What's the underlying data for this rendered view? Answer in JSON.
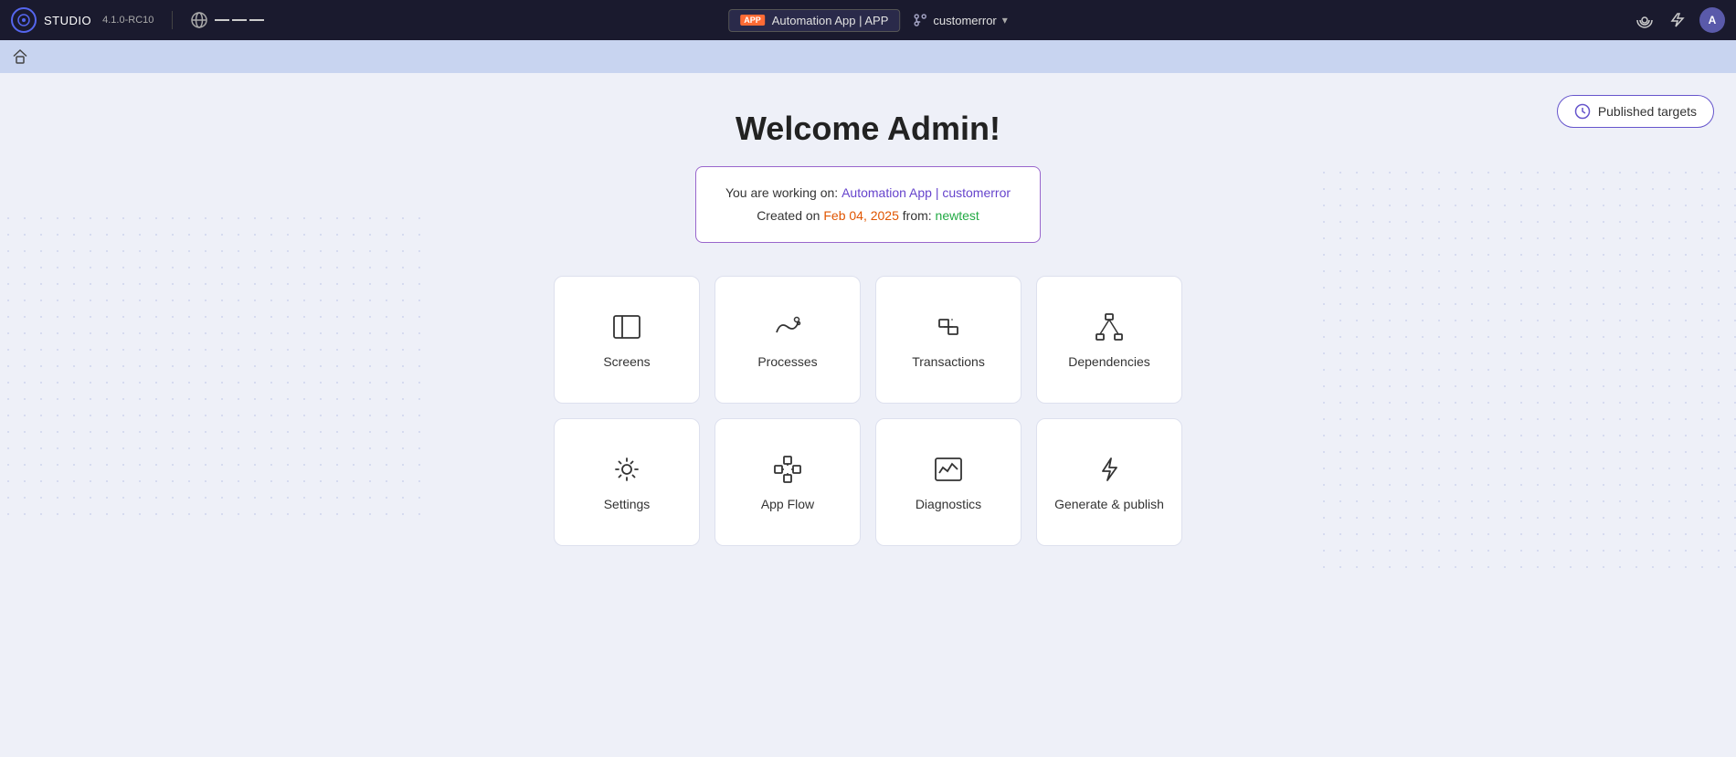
{
  "navbar": {
    "logo_text": "STUDIO",
    "version": "4.1.0-RC10",
    "app_name": "Automation App | APP",
    "branch_name": "customerror",
    "right_icons": [
      "broadcast-icon",
      "lightning-icon",
      "avatar-icon"
    ],
    "avatar_label": "A"
  },
  "sub_navbar": {
    "home_icon": "🏠"
  },
  "published_targets_btn": {
    "label": "Published targets"
  },
  "welcome": {
    "title": "Welcome Admin!",
    "working_on_label": "You are working on:",
    "app_link": "Automation App | customerror",
    "created_label": "Created on",
    "date": "Feb 04, 2025",
    "from_label": "from:",
    "branch": "newtest"
  },
  "cards": [
    {
      "id": "screens",
      "label": "Screens",
      "icon": "screens"
    },
    {
      "id": "processes",
      "label": "Processes",
      "icon": "processes"
    },
    {
      "id": "transactions",
      "label": "Transactions",
      "icon": "transactions"
    },
    {
      "id": "dependencies",
      "label": "Dependencies",
      "icon": "dependencies"
    },
    {
      "id": "settings",
      "label": "Settings",
      "icon": "settings"
    },
    {
      "id": "appflow",
      "label": "App Flow",
      "icon": "appflow"
    },
    {
      "id": "diagnostics",
      "label": "Diagnostics",
      "icon": "diagnostics"
    },
    {
      "id": "generate",
      "label": "Generate & publish",
      "icon": "generate"
    }
  ]
}
